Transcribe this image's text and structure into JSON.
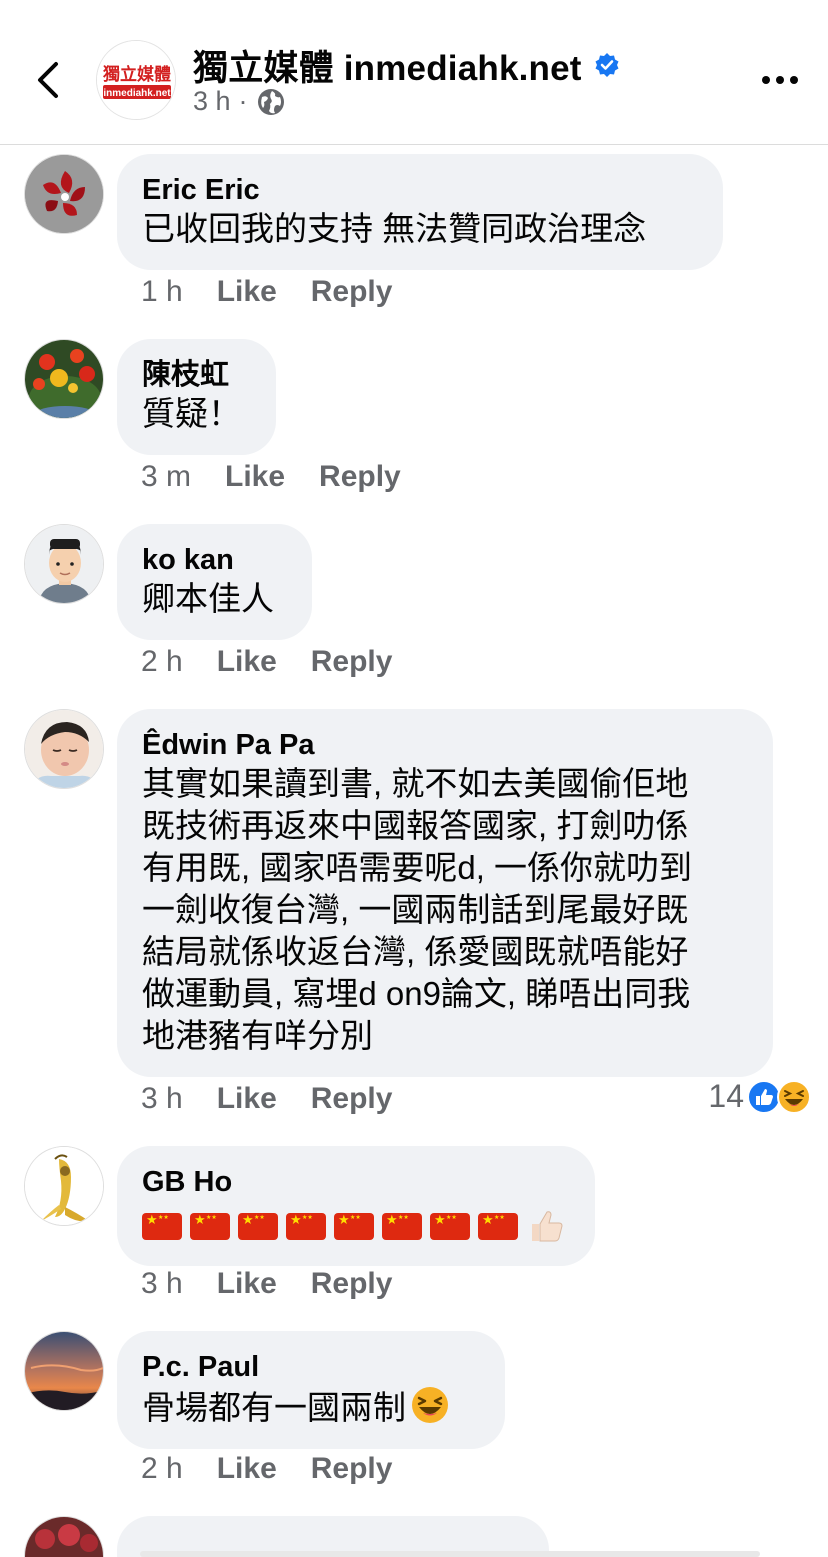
{
  "header": {
    "page_name": "獨立媒體 inmediahk.net",
    "time": "3 h",
    "separator": "·",
    "logo_text_top": "獨立媒體",
    "logo_text_bottom": "inmediahk.net",
    "brand_color": "#d32020",
    "verified_color": "#1877f2"
  },
  "comments": [
    {
      "author": "Eric Eric",
      "text": "已收回我的支持 無法贊同政治理念",
      "time": "1 h",
      "like": "Like",
      "reply": "Reply",
      "avatar_icon": "hk-flag-avatar"
    },
    {
      "author": "陳枝虹",
      "text": "質疑！",
      "time": "3 m",
      "like": "Like",
      "reply": "Reply",
      "avatar_icon": "flowers-avatar"
    },
    {
      "author": "ko kan",
      "text": "卿本佳人",
      "time": "2 h",
      "like": "Like",
      "reply": "Reply",
      "avatar_icon": "memoji-avatar"
    },
    {
      "author": "Êdwin Pa Pa",
      "lines": [
        "其實如果讀到書, 就不如去美國偷佢地",
        "既技術再返來中國報答國家, 打劍叻係",
        "有用既, 國家唔需要呢d, 一係你就叻到",
        "一劍收復台灣, 一國兩制話到尾最好既",
        "結局就係收返台灣, 係愛國既就唔能好",
        "做運動員, 寫埋d on9論文, 睇唔出同我",
        "地港豬有咩分別"
      ],
      "time": "3 h",
      "like": "Like",
      "reply": "Reply",
      "reaction_count": "14",
      "avatar_icon": "baby-avatar"
    },
    {
      "author": "GB Ho",
      "flag_count": 8,
      "time": "3 h",
      "like": "Like",
      "reply": "Reply",
      "avatar_icon": "banana-avatar"
    },
    {
      "author": "P.c. Paul",
      "text": "骨場都有一國兩制",
      "time": "2 h",
      "like": "Like",
      "reply": "Reply",
      "avatar_icon": "sunset-avatar"
    }
  ],
  "colors": {
    "bubble": "#f0f2f5",
    "meta": "#65676b",
    "like_blue": "#1877f2",
    "haha_yellow": "#f7b125"
  }
}
